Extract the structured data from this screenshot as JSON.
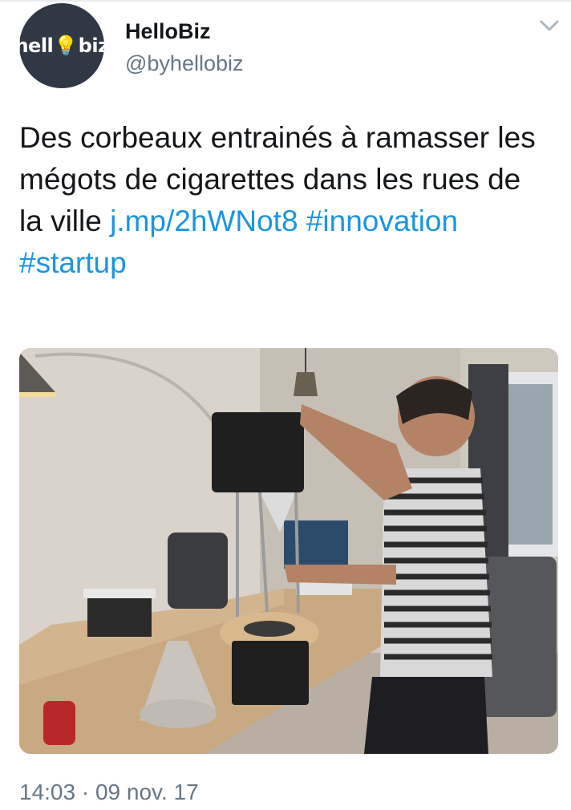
{
  "author": {
    "avatar_text_left": "hell",
    "avatar_text_right": "biz",
    "name": "HelloBiz",
    "handle": "@byhellobiz"
  },
  "tweet": {
    "text": "Des corbeaux entrainés à ramasser les mégots de cigarettes dans les rues de la ville",
    "link": "j.mp/2hWNot8",
    "hashtag_1": "#innovation",
    "hashtag_2": "#startup",
    "timestamp": "14:03 · 09 nov. 17"
  },
  "icons": {
    "menu": "chevron-down-icon",
    "bulb": "lightbulb-icon"
  },
  "colors": {
    "link": "#1b95e0",
    "secondary_text": "#657786",
    "avatar_bg": "#2f3844",
    "avatar_accent": "#f5c400"
  }
}
